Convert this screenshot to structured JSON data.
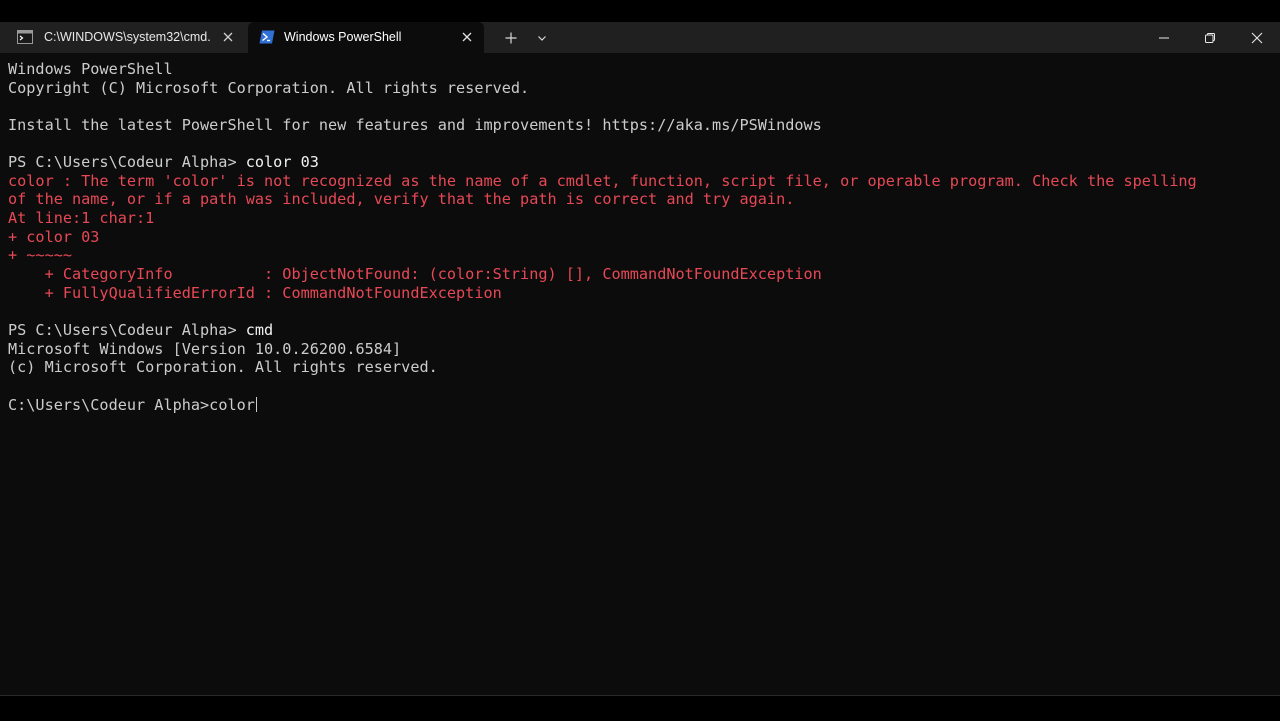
{
  "tabs": [
    {
      "title": "C:\\WINDOWS\\system32\\cmd.exe",
      "active": false
    },
    {
      "title": "Windows PowerShell",
      "active": true
    }
  ],
  "titlebar": {
    "new_tab_icon": "plus-icon",
    "dropdown_icon": "chevron-down-icon",
    "minimize_icon": "minimize-icon",
    "restore_icon": "restore-icon",
    "close_icon": "close-icon"
  },
  "colors": {
    "background": "#0c0c0c",
    "foreground": "#cccccc",
    "error": "#e74856",
    "tabbar": "#202020"
  },
  "terminal": {
    "lines": [
      {
        "prompt": "",
        "cmd": "",
        "text": "Windows PowerShell",
        "style": "normal"
      },
      {
        "prompt": "",
        "cmd": "",
        "text": "Copyright (C) Microsoft Corporation. All rights reserved.",
        "style": "normal"
      },
      {
        "prompt": "",
        "cmd": "",
        "text": "",
        "style": "normal"
      },
      {
        "prompt": "",
        "cmd": "",
        "text": "Install the latest PowerShell for new features and improvements! https://aka.ms/PSWindows",
        "style": "normal"
      },
      {
        "prompt": "",
        "cmd": "",
        "text": "",
        "style": "normal"
      },
      {
        "prompt": "PS C:\\Users\\Codeur Alpha> ",
        "cmd": "color 03",
        "text": "",
        "style": "normal"
      },
      {
        "prompt": "",
        "cmd": "",
        "text": "color : The term 'color' is not recognized as the name of a cmdlet, function, script file, or operable program. Check the spelling",
        "style": "error"
      },
      {
        "prompt": "",
        "cmd": "",
        "text": "of the name, or if a path was included, verify that the path is correct and try again.",
        "style": "error"
      },
      {
        "prompt": "",
        "cmd": "",
        "text": "At line:1 char:1",
        "style": "error"
      },
      {
        "prompt": "",
        "cmd": "",
        "text": "+ color 03",
        "style": "error"
      },
      {
        "prompt": "",
        "cmd": "",
        "text": "+ ~~~~~",
        "style": "error"
      },
      {
        "prompt": "",
        "cmd": "",
        "text": "    + CategoryInfo          : ObjectNotFound: (color:String) [], CommandNotFoundException",
        "style": "error"
      },
      {
        "prompt": "",
        "cmd": "",
        "text": "    + FullyQualifiedErrorId : CommandNotFoundException",
        "style": "error"
      },
      {
        "prompt": "",
        "cmd": "",
        "text": "",
        "style": "normal"
      },
      {
        "prompt": "PS C:\\Users\\Codeur Alpha> ",
        "cmd": "cmd",
        "text": "",
        "style": "normal"
      },
      {
        "prompt": "",
        "cmd": "",
        "text": "Microsoft Windows [Version 10.0.26200.6584]",
        "style": "normal"
      },
      {
        "prompt": "",
        "cmd": "",
        "text": "(c) Microsoft Corporation. All rights reserved.",
        "style": "normal"
      },
      {
        "prompt": "",
        "cmd": "",
        "text": "",
        "style": "normal"
      },
      {
        "prompt": "C:\\Users\\Codeur Alpha>",
        "cmd": "",
        "text": "color",
        "style": "normal",
        "cursor": true
      }
    ]
  }
}
